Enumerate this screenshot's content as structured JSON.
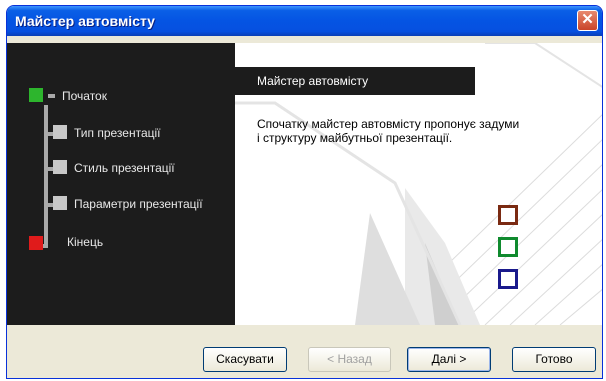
{
  "window": {
    "title": "Майстер автовмісту"
  },
  "steps": [
    {
      "label": "Початок",
      "state": "current",
      "color": "#2db52d"
    },
    {
      "label": "Тип презентації",
      "state": "pending",
      "color": "#c8c8c8"
    },
    {
      "label": "Стиль презентації",
      "state": "pending",
      "color": "#c8c8c8"
    },
    {
      "label": "Параметри презентації",
      "state": "pending",
      "color": "#c8c8c8"
    },
    {
      "label": "Кінець",
      "state": "final",
      "color": "#e01b1b"
    }
  ],
  "content": {
    "header": "Майстер автовмісту",
    "description": "Спочатку майстер автовмісту пропонує задуми і структуру майбутньої презентації."
  },
  "decor": {
    "square_colors": [
      "#7a2a12",
      "#0f8a2e",
      "#1a1a8c"
    ]
  },
  "buttons": {
    "cancel": "Скасувати",
    "back": "< Назад",
    "next": "Далі >",
    "finish": "Готово"
  }
}
